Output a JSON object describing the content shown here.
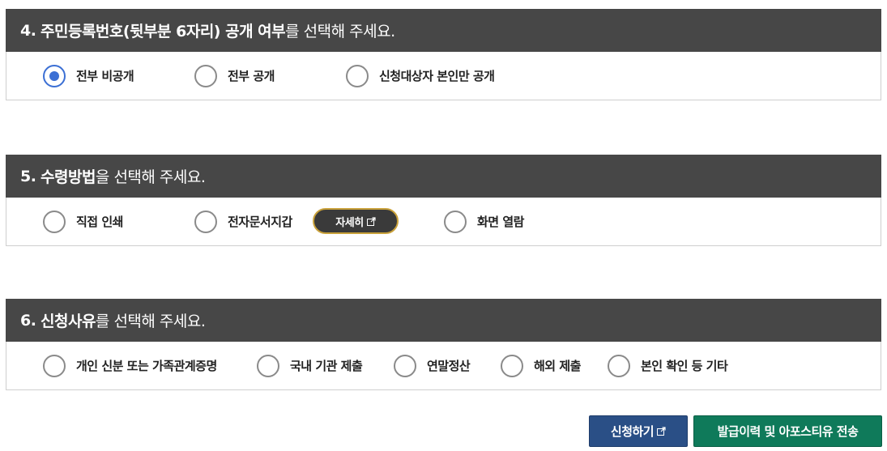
{
  "sections": [
    {
      "number": "4.",
      "title_bold": "주민등록번호(뒷부분 6자리) 공개 여부",
      "title_rest": "를 선택해 주세요.",
      "options": [
        {
          "label": "전부 비공개",
          "checked": true
        },
        {
          "label": "전부 공개",
          "checked": false
        },
        {
          "label": "신청대상자 본인만 공개",
          "checked": false
        }
      ]
    },
    {
      "number": "5.",
      "title_bold": "수령방법",
      "title_rest": "을 선택해 주세요.",
      "options": [
        {
          "label": "직접 인쇄",
          "checked": false
        },
        {
          "label": "전자문서지갑",
          "checked": false
        },
        {
          "label": "화면 열람",
          "checked": false
        }
      ],
      "detail_button": "자세히"
    },
    {
      "number": "6.",
      "title_bold": "신청사유",
      "title_rest": "를 선택해 주세요.",
      "options": [
        {
          "label": "개인 신분 또는 가족관계증명",
          "checked": false
        },
        {
          "label": "국내 기관 제출",
          "checked": false
        },
        {
          "label": "연말정산",
          "checked": false
        },
        {
          "label": "해외 제출",
          "checked": false
        },
        {
          "label": "본인 확인 등 기타",
          "checked": false
        }
      ]
    }
  ],
  "buttons": {
    "apply": "신청하기",
    "history": "발급이력 및 아포스티유 전송"
  },
  "colors": {
    "header_bg": "#474747",
    "radio_checked": "#3b6fd4",
    "apply_button": "#2a4f86",
    "history_button": "#0f7a5a",
    "detail_button_border": "#c9a13a"
  },
  "icons": {
    "external_link": "external-link-icon"
  }
}
